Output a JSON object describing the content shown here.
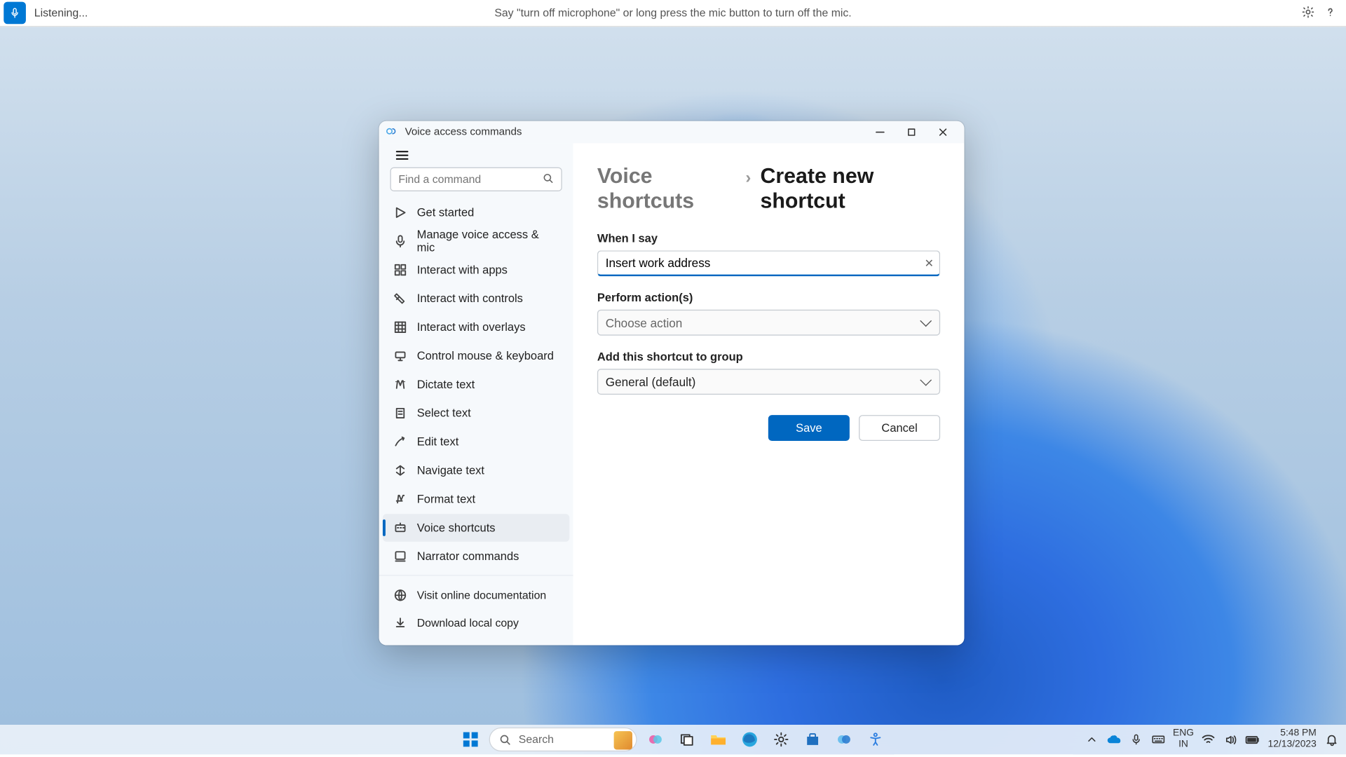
{
  "topbar": {
    "status": "Listening...",
    "hint": "Say \"turn off microphone\" or long press the mic button to turn off the mic."
  },
  "window": {
    "title": "Voice access commands",
    "search_placeholder": "Find a command",
    "nav": [
      "Get started",
      "Manage voice access & mic",
      "Interact with apps",
      "Interact with controls",
      "Interact with overlays",
      "Control mouse & keyboard",
      "Dictate text",
      "Select text",
      "Edit text",
      "Navigate text",
      "Format text",
      "Voice shortcuts",
      "Narrator commands"
    ],
    "active_nav_index": 11,
    "footer_nav": [
      "Visit online documentation",
      "Download local copy"
    ]
  },
  "content": {
    "crumb_parent": "Voice shortcuts",
    "crumb_current": "Create new shortcut",
    "label_phrase": "When I say",
    "phrase_value": "Insert work address",
    "label_actions": "Perform action(s)",
    "action_placeholder": "Choose action",
    "label_group": "Add this shortcut to group",
    "group_value": "General (default)",
    "save_label": "Save",
    "cancel_label": "Cancel"
  },
  "taskbar": {
    "search_placeholder": "Search",
    "lang_top": "ENG",
    "lang_bottom": "IN",
    "time": "5:48 PM",
    "date": "12/13/2023"
  }
}
